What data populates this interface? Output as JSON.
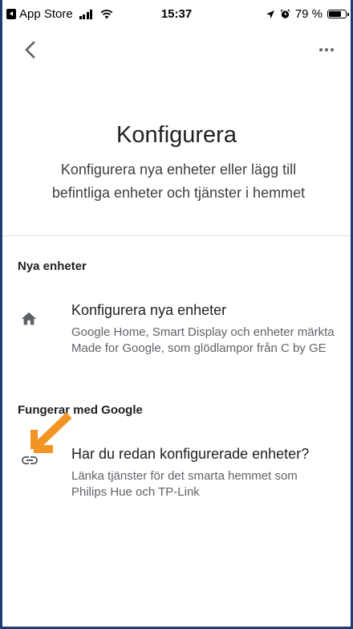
{
  "status_bar": {
    "back_app": "App Store",
    "time": "15:37",
    "battery_percent": "79 %",
    "battery_level": 0.79
  },
  "header": {
    "title": "Konfigurera",
    "subtitle": "Konfigurera nya enheter eller lägg till befintliga enheter och tjänster i hemmet"
  },
  "sections": [
    {
      "header": "Nya enheter",
      "item": {
        "icon": "home-icon",
        "title": "Konfigurera nya enheter",
        "description": "Google Home, Smart Display och enheter märkta Made for Google, som glödlampor från C by GE"
      }
    },
    {
      "header": "Fungerar med Google",
      "item": {
        "icon": "link-icon",
        "title": "Har du redan konfigurerade enheter?",
        "description": "Länka tjänster för det smarta hemmet som Philips Hue och TP-Link"
      }
    }
  ],
  "annotation": {
    "icon": "arrow-icon",
    "color": "#f29423"
  },
  "colors": {
    "frame": "#1c3b78",
    "icon_gray": "#5f6368",
    "divider": "#e0e0e0"
  }
}
